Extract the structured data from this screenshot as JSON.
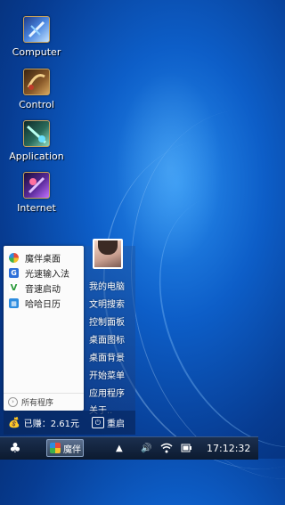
{
  "desktop": {
    "icons": [
      {
        "label": "Computer",
        "icon": "computer-icon"
      },
      {
        "label": "Control",
        "icon": "control-icon"
      },
      {
        "label": "Application",
        "icon": "application-icon"
      },
      {
        "label": "Internet",
        "icon": "internet-icon"
      }
    ]
  },
  "start_menu": {
    "apps": [
      {
        "label": "魔伴桌面",
        "icon": "mobanzhuomian-icon"
      },
      {
        "label": "光速输入法",
        "icon": "guangsu-input-icon"
      },
      {
        "label": "音速启动",
        "icon": "yinsu-launch-icon"
      },
      {
        "label": "哈哈日历",
        "icon": "haha-calendar-icon"
      }
    ],
    "all_programs": "所有程序",
    "right_items": [
      "我的电脑",
      "文明搜索",
      "控制面板",
      "桌面图标",
      "桌面背景",
      "开始菜单",
      "应用程序",
      "关于.."
    ],
    "earned": "已赚：2.61元",
    "restart": "重启"
  },
  "taskbar": {
    "active_app": "魔伴",
    "clock": "17:12:32",
    "tray": [
      "up-arrow-icon",
      "volume-icon",
      "wifi-icon",
      "battery-icon"
    ]
  },
  "colors": {
    "wallpaper": "#0d5ec8",
    "taskbar": "#0c1a2f",
    "menu_bottom": "#082860"
  }
}
